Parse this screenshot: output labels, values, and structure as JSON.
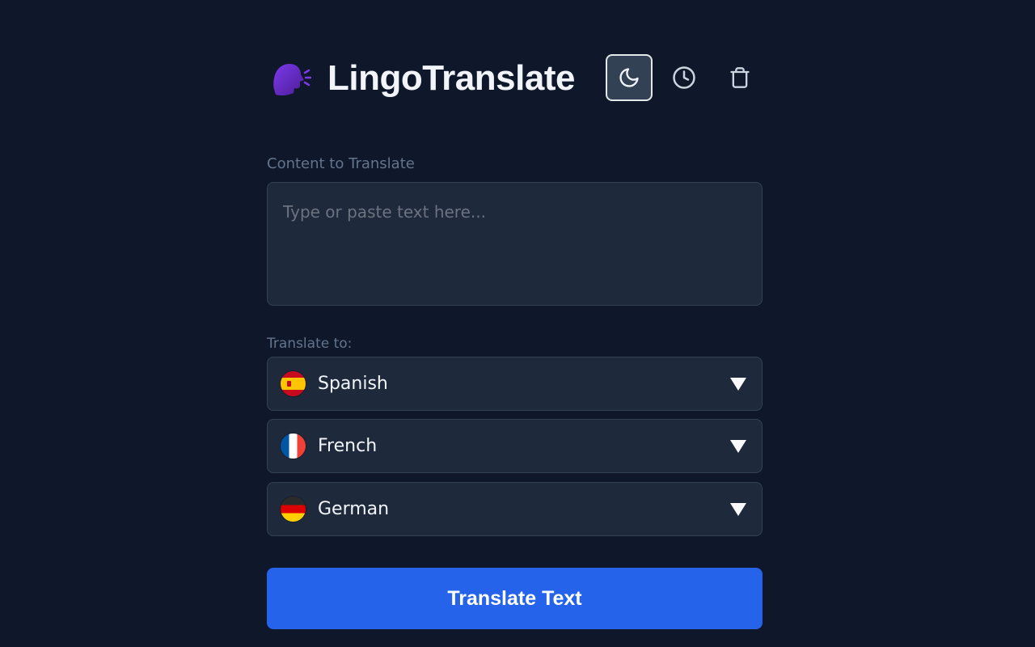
{
  "app": {
    "title": "LingoTranslate",
    "logo_icon": "speaking-head-icon"
  },
  "toolbar": {
    "theme_icon": "moon-icon",
    "history_icon": "clock-icon",
    "clear_icon": "trash-icon"
  },
  "content": {
    "label": "Content to Translate",
    "value": "",
    "placeholder": "Type or paste text here..."
  },
  "target": {
    "label": "Translate to:",
    "languages": [
      {
        "label": "Spanish",
        "flag": "spain-flag-icon"
      },
      {
        "label": "French",
        "flag": "france-flag-icon"
      },
      {
        "label": "German",
        "flag": "germany-flag-icon"
      }
    ]
  },
  "actions": {
    "translate_label": "Translate Text"
  },
  "colors": {
    "background": "#0f172a",
    "surface": "#1e293b",
    "border": "#334155",
    "accent": "#2563eb",
    "label": "#64748b"
  }
}
